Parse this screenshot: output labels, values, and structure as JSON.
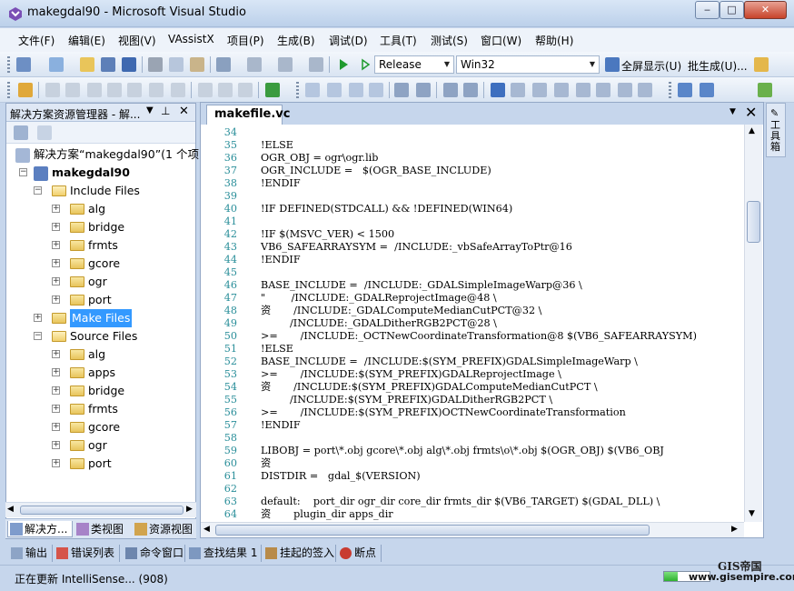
{
  "window": {
    "title": "makegdal90 - Microsoft Visual Studio",
    "min": "‒",
    "max": "□",
    "close": "✕"
  },
  "menu": [
    "文件(F)",
    "编辑(E)",
    "视图(V)",
    "VAssistX",
    "项目(P)",
    "生成(B)",
    "调试(D)",
    "工具(T)",
    "测试(S)",
    "窗口(W)",
    "帮助(H)"
  ],
  "toolbar": {
    "config": "Release",
    "platform": "Win32",
    "fullscreen": "全屏显示(U)",
    "batch_build": "批生成(U)..."
  },
  "solution_explorer": {
    "title": "解决方案资源管理器 - 解...",
    "items": [
      {
        "label": "解决方案“makegdal90”(1 个项"
      },
      {
        "label": "makegdal90"
      },
      {
        "label": "Include Files"
      },
      {
        "label": "alg"
      },
      {
        "label": "bridge"
      },
      {
        "label": "frmts"
      },
      {
        "label": "gcore"
      },
      {
        "label": "ogr"
      },
      {
        "label": "port"
      },
      {
        "label": "Make Files"
      },
      {
        "label": "Source Files"
      },
      {
        "label": "alg"
      },
      {
        "label": "apps"
      },
      {
        "label": "bridge"
      },
      {
        "label": "frmts"
      },
      {
        "label": "gcore"
      },
      {
        "label": "ogr"
      },
      {
        "label": "port"
      }
    ],
    "tabs": [
      "解决方...",
      "类视图",
      "资源视图"
    ]
  },
  "editor": {
    "tab": "makefile.vc",
    "lines": [
      {
        "n": "34",
        "t": ""
      },
      {
        "n": "35",
        "t": "!ELSE"
      },
      {
        "n": "36",
        "t": "OGR_OBJ = ogr\\ogr.lib"
      },
      {
        "n": "37",
        "t": "OGR_INCLUDE =   $(OGR_BASE_INCLUDE)"
      },
      {
        "n": "38",
        "t": "!ENDIF"
      },
      {
        "n": "39",
        "t": ""
      },
      {
        "n": "40",
        "t": "!IF DEFINED(STDCALL) && !DEFINED(WIN64)"
      },
      {
        "n": "41",
        "t": ""
      },
      {
        "n": "42",
        "t": "!IF $(MSVC_VER) < 1500"
      },
      {
        "n": "43",
        "t": "VB6_SAFEARRAYSYM =  /INCLUDE:_vbSafeArrayToPtr@16"
      },
      {
        "n": "44",
        "t": "!ENDIF"
      },
      {
        "n": "45",
        "t": ""
      },
      {
        "n": "46",
        "t": "BASE_INCLUDE =  /INCLUDE:_GDALSimpleImageWarp@36 \\"
      },
      {
        "n": "47",
        "t": "\"        /INCLUDE:_GDALReprojectImage@48 \\"
      },
      {
        "n": "48",
        "t": "资       /INCLUDE:_GDALComputeMedianCutPCT@32 \\"
      },
      {
        "n": "49",
        "t": "         /INCLUDE:_GDALDitherRGB2PCT@28 \\"
      },
      {
        "n": "50",
        "t": ">=       /INCLUDE:_OCTNewCoordinateTransformation@8 $(VB6_SAFEARRAYSYM)"
      },
      {
        "n": "51",
        "t": "!ELSE"
      },
      {
        "n": "52",
        "t": "BASE_INCLUDE =  /INCLUDE:$(SYM_PREFIX)GDALSimpleImageWarp \\"
      },
      {
        "n": "53",
        "t": ">=       /INCLUDE:$(SYM_PREFIX)GDALReprojectImage \\"
      },
      {
        "n": "54",
        "t": "资       /INCLUDE:$(SYM_PREFIX)GDALComputeMedianCutPCT \\"
      },
      {
        "n": "55",
        "t": "         /INCLUDE:$(SYM_PREFIX)GDALDitherRGB2PCT \\"
      },
      {
        "n": "56",
        "t": ">=       /INCLUDE:$(SYM_PREFIX)OCTNewCoordinateTransformation"
      },
      {
        "n": "57",
        "t": "!ENDIF"
      },
      {
        "n": "58",
        "t": ""
      },
      {
        "n": "59",
        "t": "LIBOBJ = port\\*.obj gcore\\*.obj alg\\*.obj frmts\\o\\*.obj $(OGR_OBJ) $(VB6_OBJ"
      },
      {
        "n": "60",
        "t": "资"
      },
      {
        "n": "61",
        "t": "DISTDIR =   gdal_$(VERSION)"
      },
      {
        "n": "62",
        "t": ""
      },
      {
        "n": "63",
        "t": "default:    port_dir ogr_dir core_dir frmts_dir $(VB6_TARGET) $(GDAL_DLL) \\"
      },
      {
        "n": "64",
        "t": "资       plugin_dir apps_dir"
      }
    ]
  },
  "toolbox_label": "工具箱",
  "bottom_tabs": [
    "输出",
    "错误列表",
    "命令窗口",
    "查找结果 1",
    "挂起的签入",
    "断点"
  ],
  "status": {
    "text": "正在更新 IntelliSense... (908)",
    "progress": 0.3
  },
  "watermark": {
    "brand": "GIS帝国",
    "url": "www.gisempire.com"
  }
}
